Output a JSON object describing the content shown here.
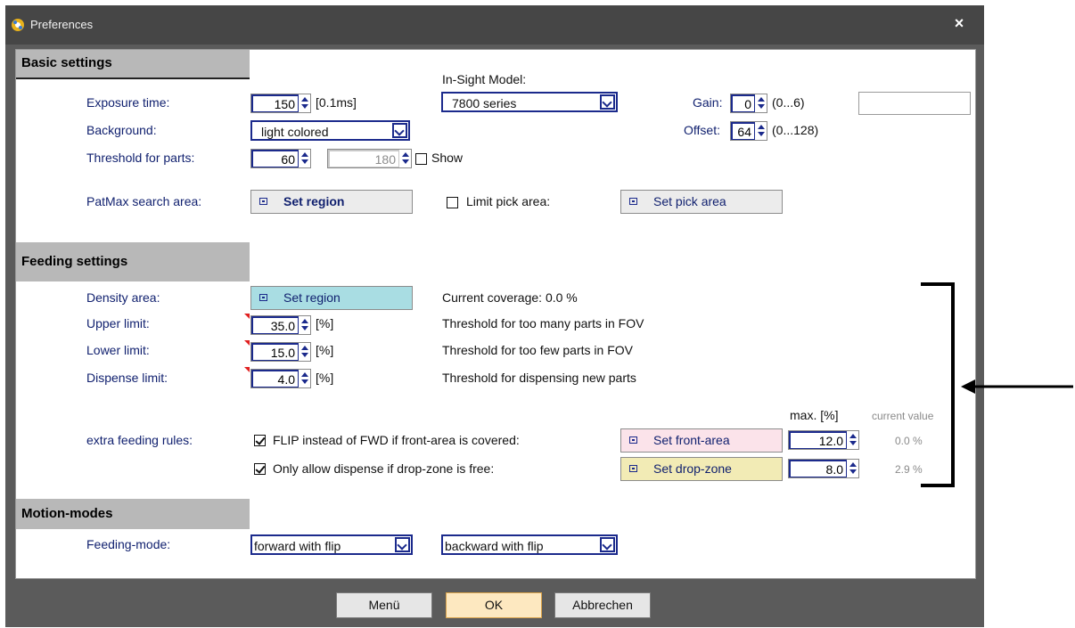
{
  "window": {
    "title": "Preferences",
    "close": "×"
  },
  "basic": {
    "header": "Basic settings",
    "insight_label": "In-Sight Model:",
    "insight_value": "7800 series",
    "exposure": {
      "label": "Exposure time:",
      "value": "150",
      "unit": "[0.1ms]"
    },
    "background": {
      "label": "Background:",
      "value": "light colored"
    },
    "threshold": {
      "label": "Threshold for parts:",
      "value1": "60",
      "value2": "180",
      "show_label": "Show"
    },
    "gain": {
      "label": "Gain:",
      "value": "0",
      "range": "(0...6)"
    },
    "offset": {
      "label": "Offset:",
      "value": "64",
      "range": "(0...128)"
    },
    "patmax": {
      "label": "PatMax search area:",
      "button": "Set region"
    },
    "limit_pick": {
      "label": "Limit pick area:",
      "button": "Set pick area"
    }
  },
  "feeding": {
    "header": "Feeding settings",
    "density": {
      "label": "Density area:",
      "button": "Set region",
      "coverage": "Current coverage:  0.0 %"
    },
    "upper": {
      "label": "Upper limit:",
      "value": "35.0",
      "unit": "[%]",
      "desc": "Threshold for too many parts in FOV"
    },
    "lower": {
      "label": "Lower limit:",
      "value": "15.0",
      "unit": "[%]",
      "desc": "Threshold for too few parts in FOV"
    },
    "dispense": {
      "label": "Dispense limit:",
      "value": "4.0",
      "unit": "[%]",
      "desc": "Threshold for dispensing new parts"
    },
    "max_header": "max. [%]",
    "current_header": "current value",
    "extra_label": "extra feeding rules:",
    "rule1": {
      "label": "FLIP instead of FWD if front-area is covered:",
      "checked": true,
      "button": "Set front-area",
      "max": "12.0",
      "current": "0.0 %"
    },
    "rule2": {
      "label": "Only allow dispense if drop-zone is free:",
      "checked": true,
      "button": "Set drop-zone",
      "max": "8.0",
      "current": "2.9 %"
    }
  },
  "motion": {
    "header": "Motion-modes",
    "label": "Feeding-mode:",
    "mode1": "forward with flip",
    "mode2": "backward with flip"
  },
  "footer": {
    "menu": "Menü",
    "ok": "OK",
    "cancel": "Abbrechen"
  },
  "colors": {
    "titlebar": "#464646",
    "frame": "#5b5b5b",
    "header": "#b8b8b8",
    "accent": "#1b2a8c",
    "density_btn": "#a9dde3",
    "front_btn": "#fbe3ea",
    "drop_btn": "#f2ebb5",
    "ok_btn": "#fde8c0"
  },
  "annotations": {
    "bracket": "bracket",
    "arrow": "arrow-left-icon"
  }
}
